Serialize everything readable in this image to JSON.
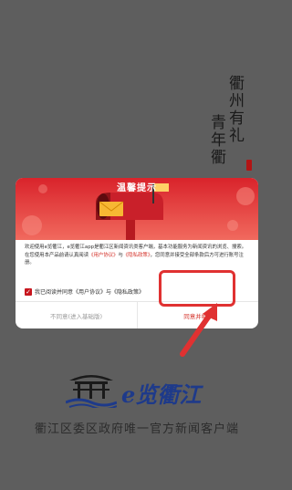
{
  "calligraphy": {
    "line1": "衢州有礼",
    "line2": "青年衢"
  },
  "dialog": {
    "title": "温馨提示",
    "body": {
      "text1": "欢迎使用e览衢江，e览衢江app是衢江区新闻资讯类客户端，基本功能服务为新闻资讯的浏览、搜索。在您使用本产品前请认真阅读",
      "user_agreement": "《用户协议》",
      "and": "与",
      "privacy_policy": "《隐私政策》",
      "text2": "，您同意并接受全部条款后方可进行账号注册。"
    },
    "agree": {
      "checked": true,
      "prefix": "我已阅读并同意",
      "user_agreement": "《用户协议》",
      "and": "与",
      "privacy_policy": "《隐私政策》"
    },
    "decline_label": "不同意(进入基础版)",
    "accept_label": "同意并继续"
  },
  "brand": {
    "logo_text": "e览衢江",
    "tagline": "衢江区委区政府唯一官方新闻客户端"
  },
  "colors": {
    "overlay": "#5e5e5e",
    "accent_red": "#d4322a",
    "highlight": "#e03131",
    "logo_blue": "#1e3a8a"
  },
  "icons": [
    "mailbox-illustration",
    "envelope-icon",
    "check-icon",
    "arrow-annotation",
    "pavilion-logo-icon"
  ]
}
